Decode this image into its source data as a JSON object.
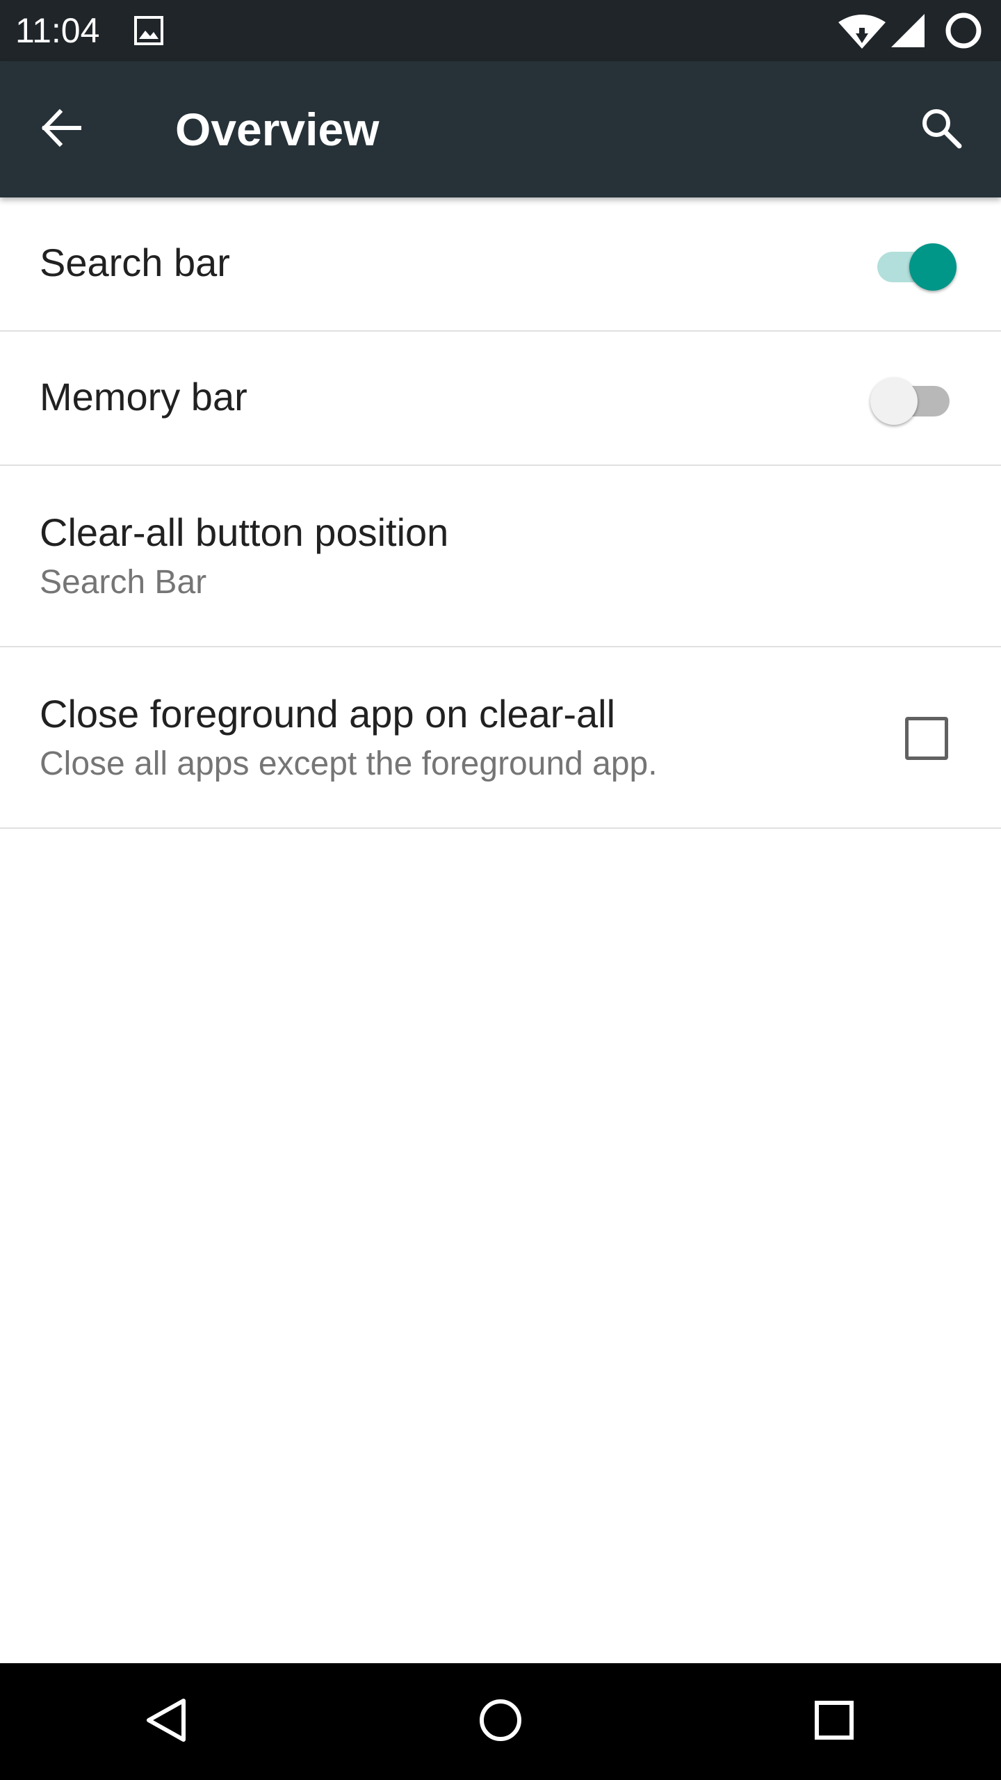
{
  "status_bar": {
    "time": "11:04",
    "icons": [
      "image-icon",
      "wifi-icon",
      "cell-signal-icon",
      "battery-icon"
    ]
  },
  "app_bar": {
    "title": "Overview",
    "background_color": "#263238",
    "back_icon": "arrow-back-icon",
    "search_icon": "search-icon"
  },
  "settings": {
    "items": [
      {
        "title": "Search bar",
        "control": "switch",
        "checked": true
      },
      {
        "title": "Memory bar",
        "control": "switch",
        "checked": false
      },
      {
        "title": "Clear-all button position",
        "summary": "Search Bar"
      },
      {
        "title": "Close foreground app on clear-all",
        "summary": "Close all apps except the foreground app.",
        "control": "checkbox",
        "checked": false
      }
    ]
  },
  "accent_color": "#009688",
  "nav_bar": {
    "icons": [
      "nav-back-icon",
      "nav-home-icon",
      "nav-recents-icon"
    ]
  }
}
